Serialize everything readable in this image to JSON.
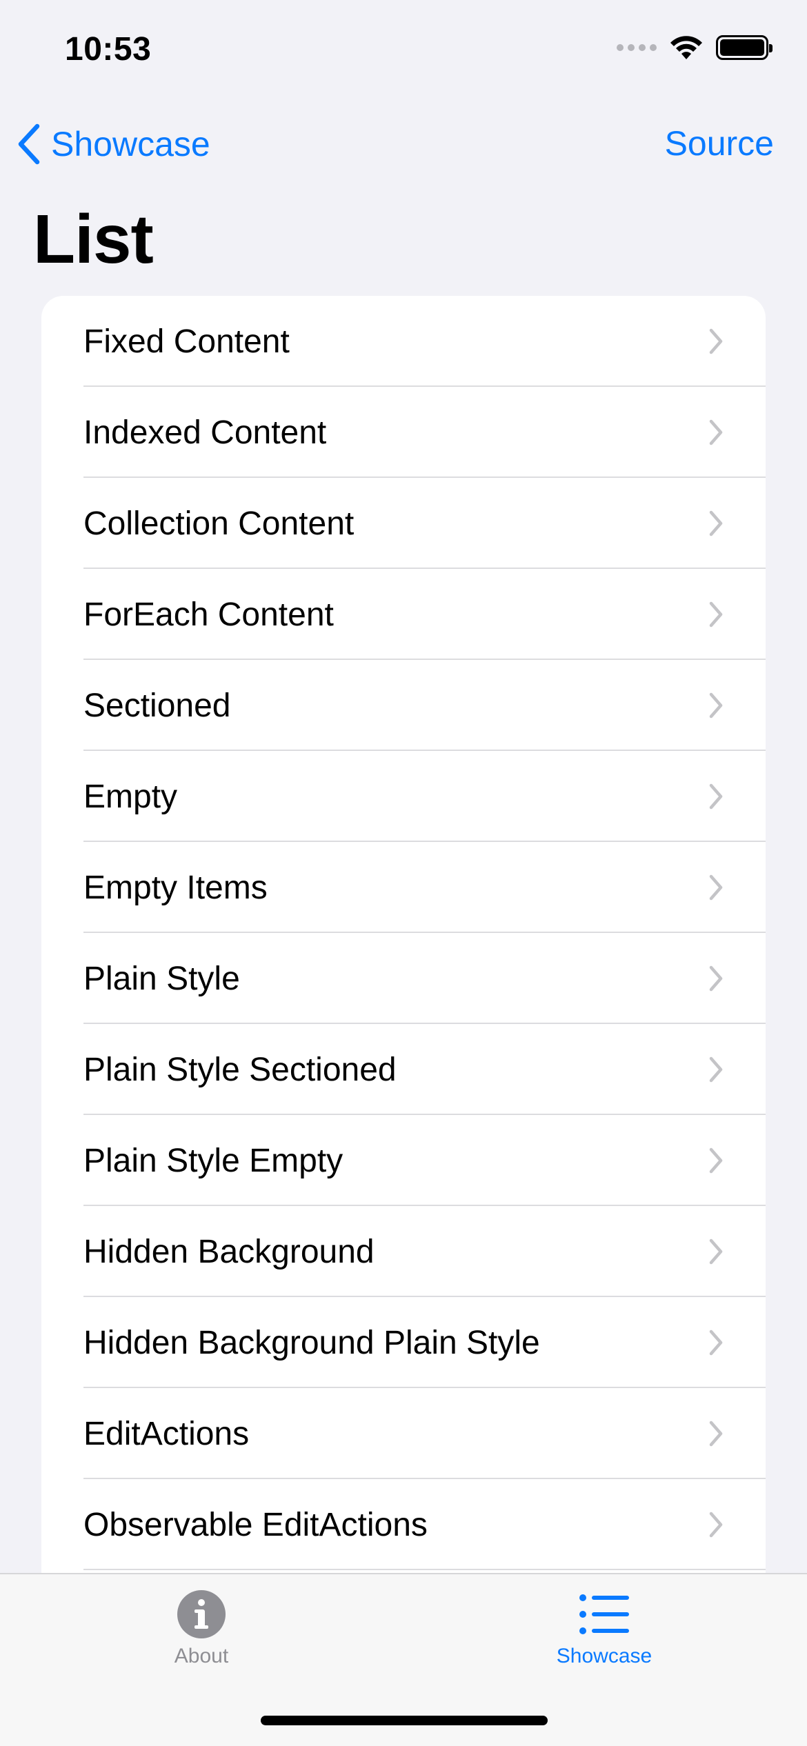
{
  "status_bar": {
    "time": "10:53"
  },
  "nav": {
    "back_label": "Showcase",
    "right_label": "Source",
    "title": "List"
  },
  "list": {
    "items": [
      {
        "label": "Fixed Content"
      },
      {
        "label": "Indexed Content"
      },
      {
        "label": "Collection Content"
      },
      {
        "label": "ForEach Content"
      },
      {
        "label": "Sectioned"
      },
      {
        "label": "Empty"
      },
      {
        "label": "Empty Items"
      },
      {
        "label": "Plain Style"
      },
      {
        "label": "Plain Style Sectioned"
      },
      {
        "label": "Plain Style Empty"
      },
      {
        "label": "Hidden Background"
      },
      {
        "label": "Hidden Background Plain Style"
      },
      {
        "label": "EditActions"
      },
      {
        "label": "Observable EditActions"
      }
    ]
  },
  "tab_bar": {
    "tabs": [
      {
        "label": "About",
        "icon": "info-circle-icon",
        "selected": false
      },
      {
        "label": "Showcase",
        "icon": "list-bullet-icon",
        "selected": true
      }
    ]
  },
  "colors": {
    "accent": "#0a7aff",
    "background": "#f2f2f7",
    "inactive": "#8e8e93"
  }
}
